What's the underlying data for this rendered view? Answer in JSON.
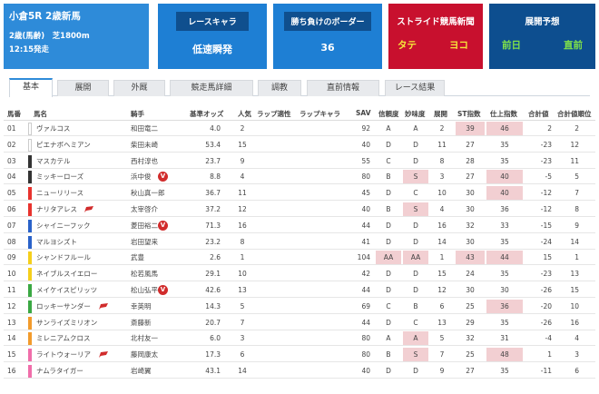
{
  "race": {
    "title": "小倉5R 2歳新馬",
    "condition": "2歳(馬齢)　芝1800m",
    "post_time": "12:15発走"
  },
  "race_character": {
    "label": "レースキャラ",
    "value": "低速瞬発"
  },
  "border": {
    "label": "勝ち負けのボーダー",
    "value": "36"
  },
  "stride": {
    "label": "ストライド競馬新聞",
    "left": "タテ",
    "right": "ヨコ"
  },
  "tenkai": {
    "label": "展開予想",
    "left": "前日",
    "right": "直前"
  },
  "tabs": [
    "基本",
    "展開",
    "外厩",
    "競走馬詳細",
    "調教",
    "直前情報",
    "レース結果"
  ],
  "active_tab": "基本",
  "columns": [
    "馬番",
    "馬名",
    "騎手",
    "基準オッズ",
    "人気",
    "ラップ適性",
    "ラップキャラ",
    "SAV",
    "信頼度",
    "妙味度",
    "展開",
    "ST指数",
    "仕上指数",
    "合計値",
    "合計値順位"
  ],
  "colors": {
    "frame": [
      "#ffffff",
      "#ffffff",
      "#333333",
      "#333333",
      "#e8332e",
      "#e8332e",
      "#2a62c9",
      "#2a62c9",
      "#f5cf1c",
      "#f5cf1c",
      "#3aa843",
      "#3aa843",
      "#f29b2c",
      "#f29b2c",
      "#f06eaa",
      "#f06eaa"
    ],
    "highlight": "#f2cfd2",
    "header_blue": "#2e8bd9",
    "stride_red": "#c8102e",
    "tenkai_navy": "#0d4e8f"
  },
  "rows": [
    {
      "no": "01",
      "name": "ヴァルコス",
      "jockey": "和田竜二",
      "odds": "4.0",
      "pop": "2",
      "sav": "92",
      "trust": "A",
      "value": "A",
      "tenkai": "2",
      "st": "39",
      "finish": "46",
      "total": "2",
      "rank": "2",
      "icon": ""
    },
    {
      "no": "02",
      "name": "ピエナボヘミアン",
      "jockey": "柴田未崎",
      "odds": "53.4",
      "pop": "15",
      "sav": "40",
      "trust": "D",
      "value": "D",
      "tenkai": "11",
      "st": "27",
      "finish": "35",
      "total": "-23",
      "rank": "12",
      "icon": ""
    },
    {
      "no": "03",
      "name": "マスカテル",
      "jockey": "西村淳也",
      "odds": "23.7",
      "pop": "9",
      "sav": "55",
      "trust": "C",
      "value": "D",
      "tenkai": "8",
      "st": "28",
      "finish": "35",
      "total": "-23",
      "rank": "11",
      "icon": ""
    },
    {
      "no": "04",
      "name": "ミッキーローズ",
      "jockey": "浜中俊",
      "odds": "8.8",
      "pop": "4",
      "sav": "80",
      "trust": "B",
      "value": "S",
      "tenkai": "3",
      "st": "27",
      "finish": "40",
      "total": "-5",
      "rank": "5",
      "icon": "v"
    },
    {
      "no": "05",
      "name": "ニューリリース",
      "jockey": "秋山真一郎",
      "odds": "36.7",
      "pop": "11",
      "sav": "45",
      "trust": "D",
      "value": "C",
      "tenkai": "10",
      "st": "30",
      "finish": "40",
      "total": "-12",
      "rank": "7",
      "icon": ""
    },
    {
      "no": "06",
      "name": "ナリタアレス",
      "jockey": "太宰啓介",
      "odds": "37.2",
      "pop": "12",
      "sav": "40",
      "trust": "B",
      "value": "S",
      "tenkai": "4",
      "st": "30",
      "finish": "36",
      "total": "-12",
      "rank": "8",
      "icon": "flag"
    },
    {
      "no": "07",
      "name": "シャイニーフック",
      "jockey": "菱田裕二",
      "odds": "71.3",
      "pop": "16",
      "sav": "44",
      "trust": "D",
      "value": "D",
      "tenkai": "16",
      "st": "32",
      "finish": "33",
      "total": "-15",
      "rank": "9",
      "icon": "v"
    },
    {
      "no": "08",
      "name": "マルヨシズト",
      "jockey": "岩田望来",
      "odds": "23.2",
      "pop": "8",
      "sav": "41",
      "trust": "D",
      "value": "D",
      "tenkai": "14",
      "st": "30",
      "finish": "35",
      "total": "-24",
      "rank": "14",
      "icon": ""
    },
    {
      "no": "09",
      "name": "シャンドフルール",
      "jockey": "武豊",
      "odds": "2.6",
      "pop": "1",
      "sav": "104",
      "trust": "AA",
      "value": "AA",
      "tenkai": "1",
      "st": "43",
      "finish": "44",
      "total": "15",
      "rank": "1",
      "icon": ""
    },
    {
      "no": "10",
      "name": "ネイブルスイエロー",
      "jockey": "松若風馬",
      "odds": "29.1",
      "pop": "10",
      "sav": "42",
      "trust": "D",
      "value": "D",
      "tenkai": "15",
      "st": "24",
      "finish": "35",
      "total": "-23",
      "rank": "13",
      "icon": ""
    },
    {
      "no": "11",
      "name": "メイケイスピリッツ",
      "jockey": "松山弘平",
      "odds": "42.6",
      "pop": "13",
      "sav": "44",
      "trust": "D",
      "value": "D",
      "tenkai": "12",
      "st": "30",
      "finish": "30",
      "total": "-26",
      "rank": "15",
      "icon": "v"
    },
    {
      "no": "12",
      "name": "ロッキーサンダー",
      "jockey": "幸英明",
      "odds": "14.3",
      "pop": "5",
      "sav": "69",
      "trust": "C",
      "value": "B",
      "tenkai": "6",
      "st": "25",
      "finish": "36",
      "total": "-20",
      "rank": "10",
      "icon": "flag"
    },
    {
      "no": "13",
      "name": "サンライズミリオン",
      "jockey": "斎藤新",
      "odds": "20.7",
      "pop": "7",
      "sav": "44",
      "trust": "D",
      "value": "C",
      "tenkai": "13",
      "st": "29",
      "finish": "35",
      "total": "-26",
      "rank": "16",
      "icon": ""
    },
    {
      "no": "14",
      "name": "ミレニアムクロス",
      "jockey": "北村友一",
      "odds": "6.0",
      "pop": "3",
      "sav": "80",
      "trust": "A",
      "value": "A",
      "tenkai": "5",
      "st": "32",
      "finish": "31",
      "total": "-4",
      "rank": "4",
      "icon": ""
    },
    {
      "no": "15",
      "name": "ライトウォーリア",
      "jockey": "藤岡康太",
      "odds": "17.3",
      "pop": "6",
      "sav": "80",
      "trust": "B",
      "value": "S",
      "tenkai": "7",
      "st": "25",
      "finish": "48",
      "total": "1",
      "rank": "3",
      "icon": "flag"
    },
    {
      "no": "16",
      "name": "ナムラタイガー",
      "jockey": "岩崎翼",
      "odds": "43.1",
      "pop": "14",
      "sav": "40",
      "trust": "D",
      "value": "D",
      "tenkai": "9",
      "st": "27",
      "finish": "35",
      "total": "-11",
      "rank": "6",
      "icon": ""
    }
  ],
  "highlights": {
    "st": [
      "01",
      "09"
    ],
    "finish": [
      "01",
      "04",
      "05",
      "09",
      "12",
      "15"
    ],
    "value": [
      "04",
      "06",
      "09",
      "14",
      "15"
    ],
    "trust": [
      "09"
    ]
  }
}
